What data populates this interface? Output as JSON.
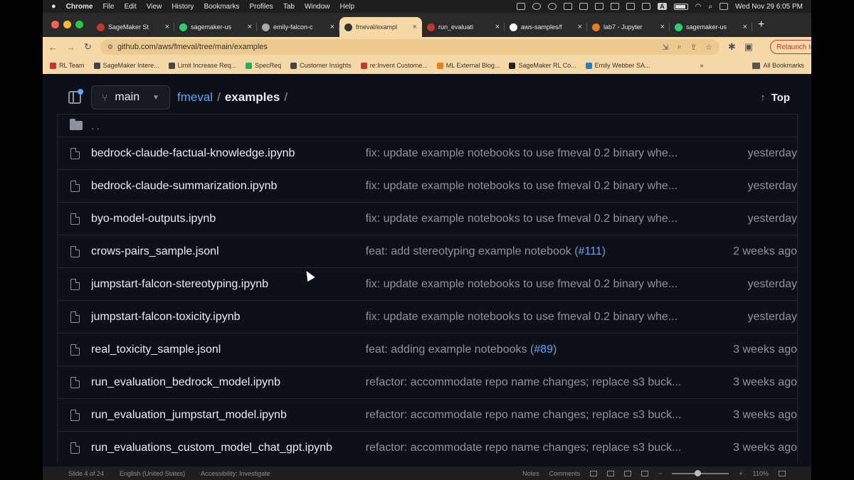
{
  "menubar": {
    "app": "Chrome",
    "items": [
      "File",
      "Edit",
      "View",
      "History",
      "Bookmarks",
      "Profiles",
      "Tab",
      "Window",
      "Help"
    ],
    "input_source": "A",
    "clock": "Wed Nov 29  6:05 PM"
  },
  "tabs": [
    {
      "title": "SageMaker St",
      "favicon_color": "#c0392b"
    },
    {
      "title": "sagemaker-us",
      "favicon_color": "#2ecc71"
    },
    {
      "title": "emily-falcon-c",
      "favicon_color": "#aaaaaa"
    },
    {
      "title": "fmeval/exampl",
      "favicon_color": "#333333",
      "active": true
    },
    {
      "title": "run_evaluati",
      "favicon_color": "#c0392b"
    },
    {
      "title": "aws-samples/f",
      "favicon_color": "#ffffff"
    },
    {
      "title": "lab7 - Jupyter",
      "favicon_color": "#e67e22"
    },
    {
      "title": "sagemaker-us",
      "favicon_color": "#2ecc71"
    }
  ],
  "toolbar": {
    "url": "github.com/aws/fmeval/tree/main/examples",
    "relaunch": "Relaunch to update"
  },
  "bookmarks": [
    {
      "label": "RL Team",
      "color": "#c0392b"
    },
    {
      "label": "SageMaker Intere...",
      "color": "#444444"
    },
    {
      "label": "Limit Increase Req...",
      "color": "#444444"
    },
    {
      "label": "SpecReq",
      "color": "#27ae60"
    },
    {
      "label": "Customer Insights",
      "color": "#444444"
    },
    {
      "label": "re:Invent Custome...",
      "color": "#c0392b"
    },
    {
      "label": "ML External Blog...",
      "color": "#e67e22"
    },
    {
      "label": "SageMaker RL Co...",
      "color": "#222222"
    },
    {
      "label": "Emily Webber SA...",
      "color": "#2980b9"
    }
  ],
  "all_bookmarks": "All Bookmarks",
  "repo": {
    "branch": "main",
    "repo_name": "fmeval",
    "folder": "examples",
    "sep": "/",
    "top": "Top",
    "parent": ". ."
  },
  "files": [
    {
      "name": "bedrock-claude-factual-knowledge.ipynb",
      "commit": "fix: update example notebooks to use fmeval 0.2 binary whe...",
      "pr": "",
      "tail": "",
      "age": "yesterday"
    },
    {
      "name": "bedrock-claude-summarization.ipynb",
      "commit": "fix: update example notebooks to use fmeval 0.2 binary whe...",
      "pr": "",
      "tail": "",
      "age": "yesterday"
    },
    {
      "name": "byo-model-outputs.ipynb",
      "commit": "fix: update example notebooks to use fmeval 0.2 binary whe...",
      "pr": "",
      "tail": "",
      "age": "yesterday"
    },
    {
      "name": "crows-pairs_sample.jsonl",
      "commit": "feat: add stereotyping example notebook (",
      "pr": "#111",
      "tail": ")",
      "age": "2 weeks ago"
    },
    {
      "name": "jumpstart-falcon-stereotyping.ipynb",
      "commit": "fix: update example notebooks to use fmeval 0.2 binary whe...",
      "pr": "",
      "tail": "",
      "age": "yesterday"
    },
    {
      "name": "jumpstart-falcon-toxicity.ipynb",
      "commit": "fix: update example notebooks to use fmeval 0.2 binary whe...",
      "pr": "",
      "tail": "",
      "age": "yesterday"
    },
    {
      "name": "real_toxicity_sample.jsonl",
      "commit": "feat: adding example notebooks (",
      "pr": "#89",
      "tail": ")",
      "age": "3 weeks ago"
    },
    {
      "name": "run_evaluation_bedrock_model.ipynb",
      "commit": "refactor: accommodate repo name changes; replace s3 buck...",
      "pr": "",
      "tail": "",
      "age": "3 weeks ago"
    },
    {
      "name": "run_evaluation_jumpstart_model.ipynb",
      "commit": "refactor: accommodate repo name changes; replace s3 buck...",
      "pr": "",
      "tail": "",
      "age": "3 weeks ago"
    },
    {
      "name": "run_evaluations_custom_model_chat_gpt.ipynb",
      "commit": "refactor: accommodate repo name changes; replace s3 buck...",
      "pr": "",
      "tail": "",
      "age": "3 weeks ago"
    }
  ],
  "statusbar": {
    "slide": "Slide 4 of 24",
    "language": "English (United States)",
    "accessibility": "Accessibility: Investigate",
    "notes": "Notes",
    "comments": "Comments",
    "zoom": "110%",
    "zoom_level": 0.45
  }
}
